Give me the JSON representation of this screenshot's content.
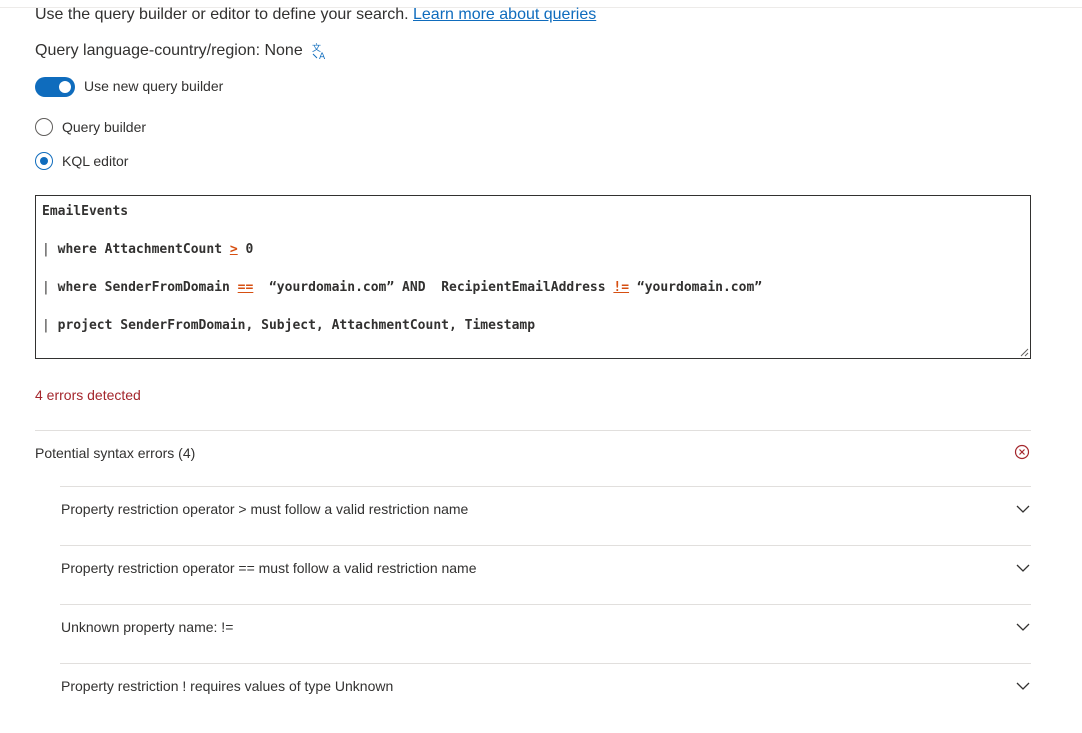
{
  "intro": {
    "text": "Use the query builder or editor to define your search.",
    "link": "Learn more about queries"
  },
  "language": {
    "text": "Query language-country/region: None",
    "icon": "translate-icon"
  },
  "toggle": {
    "label": "Use new query builder",
    "on": true
  },
  "modes": [
    {
      "label": "Query builder",
      "selected": false
    },
    {
      "label": "KQL editor",
      "selected": true
    }
  ],
  "editor": {
    "line1": "EmailEvents",
    "line2_a": "where AttachmentCount",
    "line2_op": ">",
    "line2_b": "0",
    "line3_a": "where SenderFromDomain",
    "line3_op": "==",
    "line3_b": "“yourdomain.com” AND",
    "line3_c": "RecipientEmailAddress",
    "line3_op2": "!=",
    "line3_d": "“yourdomain.com”",
    "line4": "project SenderFromDomain, Subject, AttachmentCount, Timestamp",
    "pipe": "|"
  },
  "errors_count": "4 errors detected",
  "syntax_errors": {
    "title": "Potential syntax errors (4)",
    "items": [
      "Property restriction operator > must follow a valid restriction name",
      "Property restriction operator == must follow a valid restriction name",
      "Unknown property name: !=",
      "Property restriction ! requires values of type Unknown"
    ]
  },
  "colors": {
    "accent": "#0f6cbd",
    "error": "#a4262c",
    "operator": "#d64f11"
  }
}
